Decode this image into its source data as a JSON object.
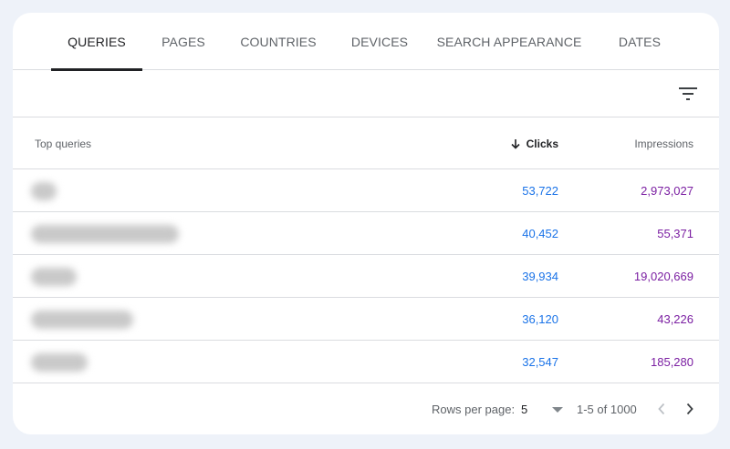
{
  "tabs": [
    {
      "label": "QUERIES",
      "active": true
    },
    {
      "label": "PAGES"
    },
    {
      "label": "COUNTRIES"
    },
    {
      "label": "DEVICES"
    },
    {
      "label": "SEARCH APPEARANCE"
    },
    {
      "label": "DATES"
    }
  ],
  "toolbar": {
    "filter_icon": "filter-icon"
  },
  "table": {
    "headers": {
      "query": "Top queries",
      "clicks": "Clicks",
      "impressions": "Impressions"
    },
    "sort": {
      "column": "clicks",
      "direction": "descending",
      "icon": "arrow-down-icon"
    },
    "rows": [
      {
        "query": "",
        "clicks": "53,722",
        "impressions": "2,973,027"
      },
      {
        "query": "",
        "clicks": "40,452",
        "impressions": "55,371"
      },
      {
        "query": "",
        "clicks": "39,934",
        "impressions": "19,020,669"
      },
      {
        "query": "",
        "clicks": "36,120",
        "impressions": "43,226"
      },
      {
        "query": "",
        "clicks": "32,547",
        "impressions": "185,280"
      }
    ]
  },
  "pagination": {
    "rows_per_page_label": "Rows per page:",
    "rows_per_page": "5",
    "range": "1-5 of 1000",
    "prev_icon": "chevron-left-icon",
    "next_icon": "chevron-right-icon"
  },
  "colors": {
    "clicks": "#1a73e8",
    "impressions": "#7b1fa2",
    "active_tab": "#202124",
    "background": "#eef2f9"
  }
}
